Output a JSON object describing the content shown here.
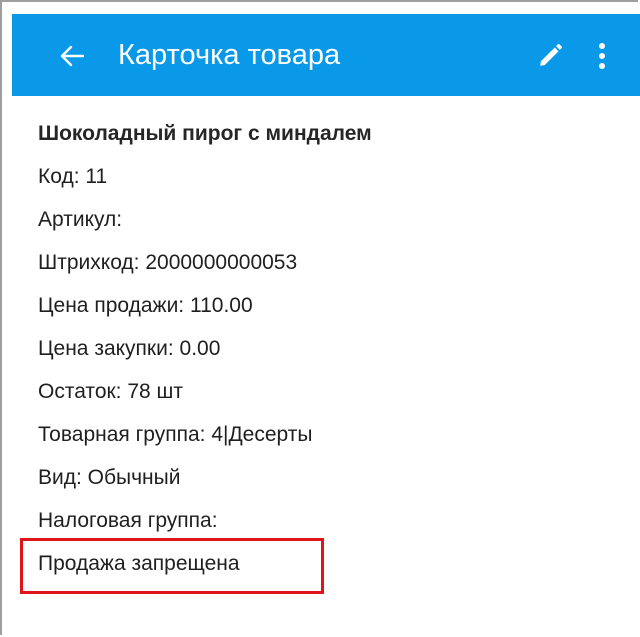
{
  "appbar": {
    "title": "Карточка товара",
    "back_icon": "arrow-left-icon",
    "edit_icon": "pencil-icon",
    "more_icon": "more-vert-icon",
    "color": "#0a98e8"
  },
  "product": {
    "name": "Шоколадный пирог с миндалем",
    "code": "Код: 11",
    "article": "Артикул:",
    "barcode": "Штрихкод: 2000000000053",
    "sale_price": "Цена продажи: 110.00",
    "purchase_price": "Цена закупки: 0.00",
    "stock": "Остаток: 78 шт",
    "group": "Товарная группа: 4|Десерты",
    "kind": "Вид: Обычный",
    "tax_group": "Налоговая группа:",
    "sale_status": "Продажа запрещена"
  },
  "highlight_color": "#e0151b"
}
